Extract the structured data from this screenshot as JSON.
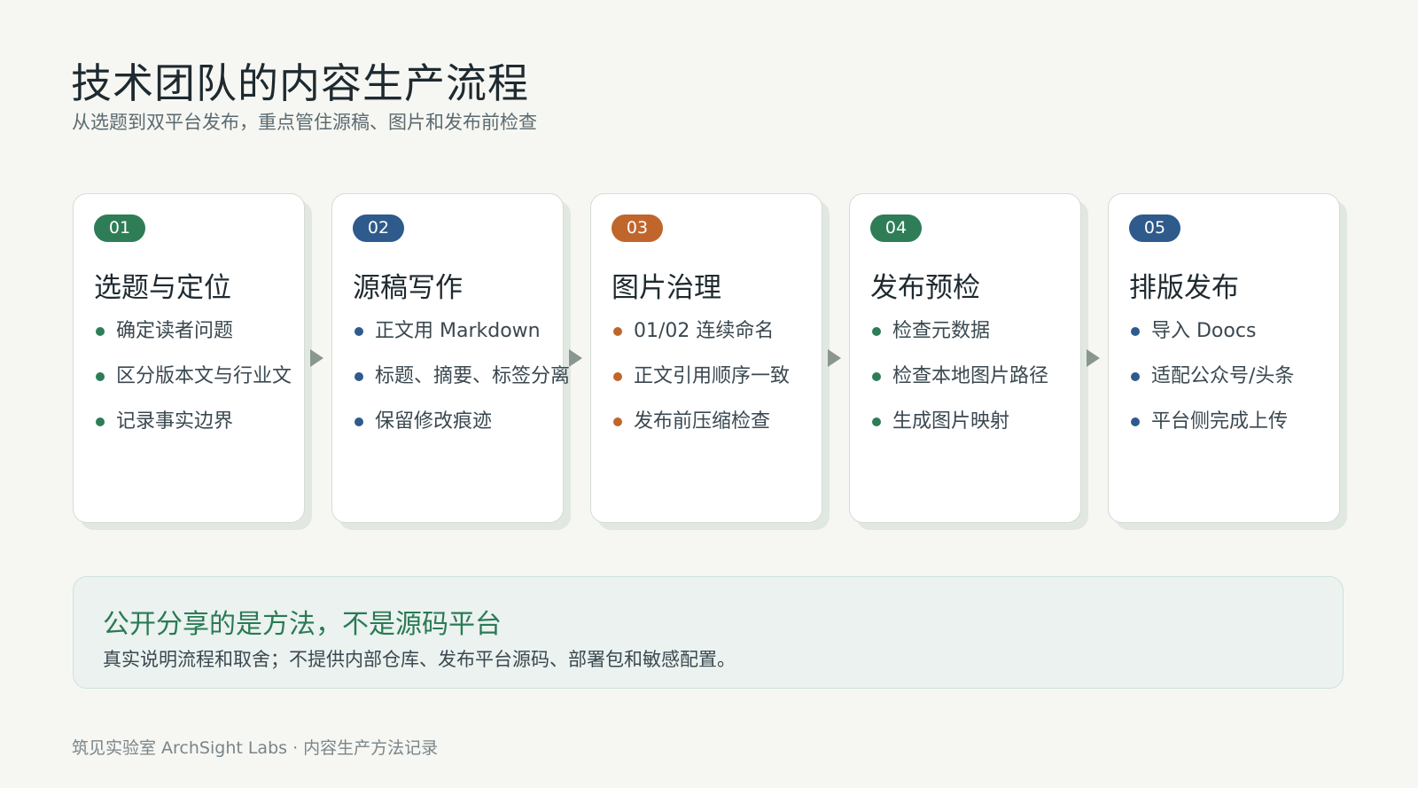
{
  "page": {
    "title": "技术团队的内容生产流程",
    "subtitle": "从选题到双平台发布，重点管住源稿、图片和发布前检查"
  },
  "steps": [
    {
      "num": "01",
      "color": "#2e7d57",
      "title": "选题与定位",
      "items": [
        "确定读者问题",
        "区分版本文与行业文",
        "记录事实边界"
      ]
    },
    {
      "num": "02",
      "color": "#2e5a8c",
      "title": "源稿写作",
      "items": [
        "正文用 Markdown",
        "标题、摘要、标签分离",
        "保留修改痕迹"
      ]
    },
    {
      "num": "03",
      "color": "#c0662c",
      "title": "图片治理",
      "items": [
        "01/02 连续命名",
        "正文引用顺序一致",
        "发布前压缩检查"
      ]
    },
    {
      "num": "04",
      "color": "#2e7d57",
      "title": "发布预检",
      "items": [
        "检查元数据",
        "检查本地图片路径",
        "生成图片映射"
      ]
    },
    {
      "num": "05",
      "color": "#2e5a8c",
      "title": "排版发布",
      "items": [
        "导入 Doocs",
        "适配公众号/头条",
        "平台侧完成上传"
      ]
    }
  ],
  "note": {
    "title": "公开分享的是方法，不是源码平台",
    "text": "真实说明流程和取舍；不提供内部仓库、发布平台源码、部署包和敏感配置。"
  },
  "footer": "筑见实验室 ArchSight Labs · 内容生产方法记录"
}
